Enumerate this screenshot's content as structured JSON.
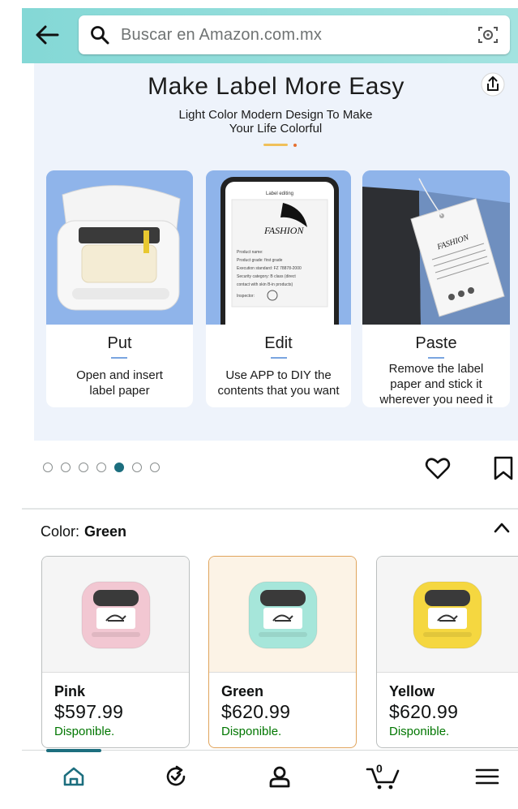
{
  "search": {
    "placeholder": "Buscar en Amazon.com.mx"
  },
  "banner": {
    "title": "Make Label More Easy",
    "subtitle_line1": "Light Color Modern Design To Make",
    "subtitle_line2": "Your Life Colorful",
    "steps": [
      {
        "title": "Put",
        "desc_line1": "Open and insert",
        "desc_line2": "label paper",
        "desc_line3": ""
      },
      {
        "title": "Edit",
        "desc_line1": "Use APP to DIY the",
        "desc_line2": "contents that you want",
        "desc_line3": ""
      },
      {
        "title": "Paste",
        "desc_line1": "Remove the label",
        "desc_line2": "paper and stick it",
        "desc_line3": "wherever you need it"
      }
    ],
    "phone_screen": {
      "header": "Label editing",
      "brand": "FASHION",
      "lines": [
        "Product name:",
        "Product grade: first grade",
        "Execution standard: FZ 78878-2000",
        "Security category: B class (direct",
        "contact with skin B-in products)",
        "Inspector:"
      ]
    },
    "tag_brand": "FASHION"
  },
  "carousel": {
    "total": 7,
    "active_index": 4
  },
  "color": {
    "label": "Color:",
    "selected": "Green"
  },
  "variants": [
    {
      "name": "Pink",
      "price": "$597.99",
      "availability": "Disponible.",
      "color": "#f2c7d2"
    },
    {
      "name": "Green",
      "price": "$620.99",
      "availability": "Disponible.",
      "color": "#a6e6da"
    },
    {
      "name": "Yellow",
      "price": "$620.99",
      "availability": "Disponible.",
      "color": "#f5d740"
    }
  ],
  "nav": {
    "cart_count": "0",
    "active": "home"
  },
  "colors": {
    "header_start": "#84d8d6",
    "accent": "#1c6e7e",
    "available": "#007600",
    "selected_border": "#e0a45c"
  },
  "icons": [
    "back-arrow-icon",
    "search-icon",
    "camera-lens-icon",
    "share-icon",
    "heart-icon",
    "bookmark-icon",
    "chevron-up-icon",
    "home-icon",
    "refresh-check-icon",
    "account-icon",
    "cart-icon",
    "menu-icon"
  ]
}
